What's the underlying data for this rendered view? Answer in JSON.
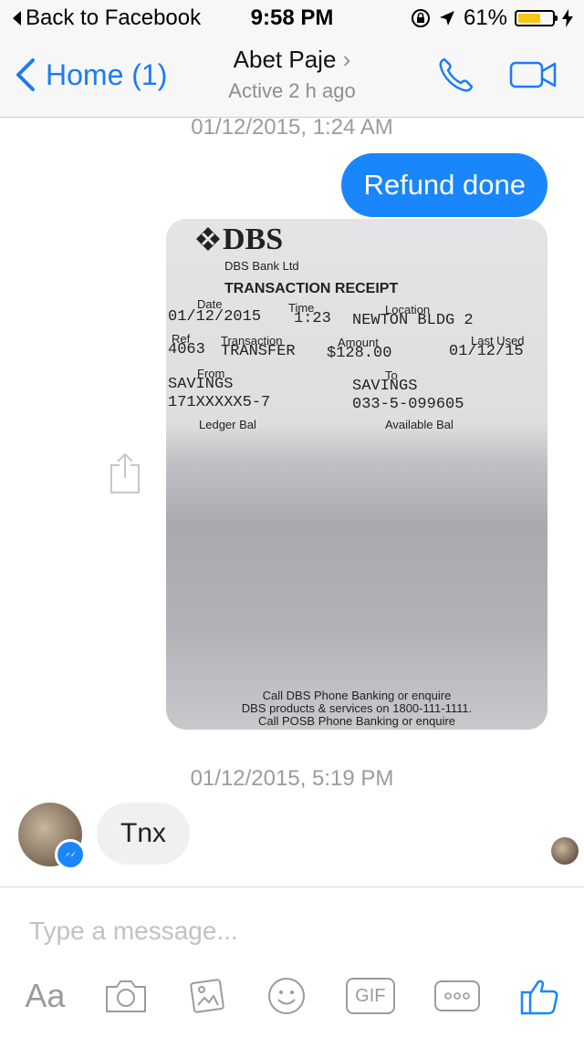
{
  "status_bar": {
    "back_label": "Back to Facebook",
    "time": "9:58 PM",
    "battery": "61%",
    "battery_color": "#f5c518"
  },
  "nav": {
    "home_label": "Home (1)",
    "contact_name": "Abet Paje",
    "contact_status": "Active 2 h ago",
    "accent": "#1a7cf5"
  },
  "messages": {
    "timestamp_1": "01/12/2015, 1:24 AM",
    "outgoing_text": "Refund done",
    "timestamp_2": "01/12/2015, 5:19 PM",
    "incoming_text": "Tnx"
  },
  "receipt": {
    "logo": "DBS",
    "bank": "DBS Bank Ltd",
    "heading": "TRANSACTION RECEIPT",
    "date_label": "Date",
    "date": "01/12/2015",
    "time_label": "Time",
    "time": "1:23",
    "location_label": "Location",
    "location": "NEWTON BLDG 2",
    "ref_label": "Ref",
    "ref": "4063",
    "transaction_label": "Transaction",
    "transaction": "TRANSFER",
    "amount_label": "Amount",
    "amount": "$128.00",
    "last_used_label": "Last Used",
    "last_used": "01/12/15",
    "from_label": "From",
    "from_type": "SAVINGS",
    "from_account": "171XXXXX5-7",
    "to_label": "To",
    "to_type": "SAVINGS",
    "to_account": "033-5-099605",
    "ledger_label": "Ledger Bal",
    "available_label": "Available Bal",
    "footer_1": "Call DBS Phone Banking or enquire",
    "footer_2": "DBS products & services on 1800-111-1111.",
    "footer_3": "Call POSB Phone Banking or enquire"
  },
  "composer": {
    "placeholder": "Type a message...",
    "tools": [
      "Aa",
      "camera-icon",
      "photo-icon",
      "emoji-icon",
      "GIF",
      "more-icon",
      "like-icon"
    ]
  }
}
